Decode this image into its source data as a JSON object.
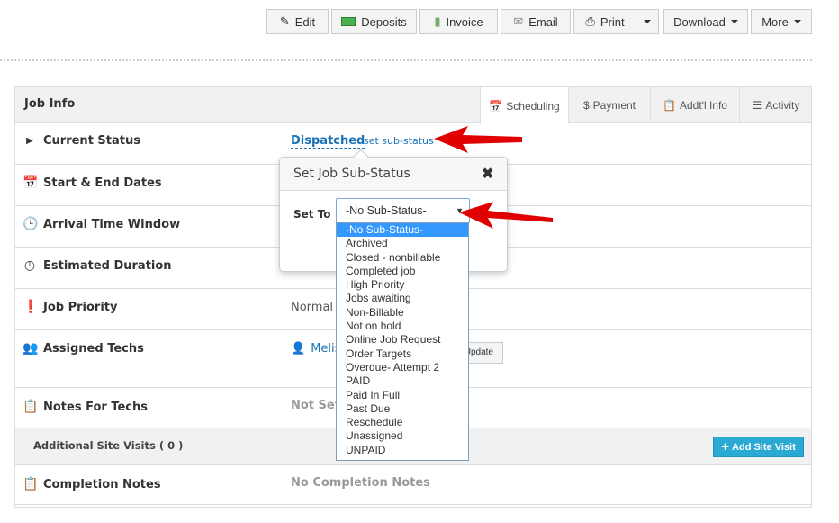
{
  "toolbar": {
    "edit": "Edit",
    "deposits": "Deposits",
    "invoice": "Invoice",
    "email": "Email",
    "print": "Print",
    "download": "Download",
    "more": "More"
  },
  "panel": {
    "title": "Job Info",
    "tabs": [
      {
        "label": "Scheduling",
        "icon": "calendar-icon"
      },
      {
        "label": "Payment",
        "icon": "coins-icon"
      },
      {
        "label": "Addt'l Info",
        "icon": "clipboard-icon"
      },
      {
        "label": "Activity",
        "icon": "list-icon"
      }
    ]
  },
  "rows": {
    "current_status": {
      "label": "Current Status",
      "value": "Dispatched",
      "link": "set sub-status"
    },
    "dates": {
      "label": "Start & End Dates"
    },
    "arrival": {
      "label": "Arrival Time Window"
    },
    "duration": {
      "label": "Estimated Duration"
    },
    "priority": {
      "label": "Job Priority",
      "value": "Normal"
    },
    "techs": {
      "label": "Assigned Techs",
      "value": "Melis",
      "update": "Update"
    },
    "notes": {
      "label": "Notes For Techs",
      "value": "Not Set"
    },
    "site_visits": {
      "label": "Additional Site Visits ( 0 )",
      "button": "Add Site Visit"
    },
    "completion": {
      "label": "Completion Notes",
      "value": "No Completion Notes"
    }
  },
  "popover": {
    "title": "Set Job Sub-Status",
    "set_to": "Set To",
    "selected": "-No Sub-Status-",
    "options": [
      "-No Sub-Status-",
      "Archived",
      "Closed - nonbillable",
      "Completed job",
      "High Priority",
      "Jobs awaiting",
      "Non-Billable",
      "Not on hold",
      "Online Job Request",
      "Order Targets",
      "Overdue- Attempt 2",
      "PAID",
      "Paid In Full",
      "Past Due",
      "Reschedule",
      "Unassigned",
      "UNPAID"
    ]
  },
  "colors": {
    "link": "#1a73b8",
    "accent": "#2aa9d2",
    "selection": "#3399ff",
    "arrow": "#e00000"
  }
}
